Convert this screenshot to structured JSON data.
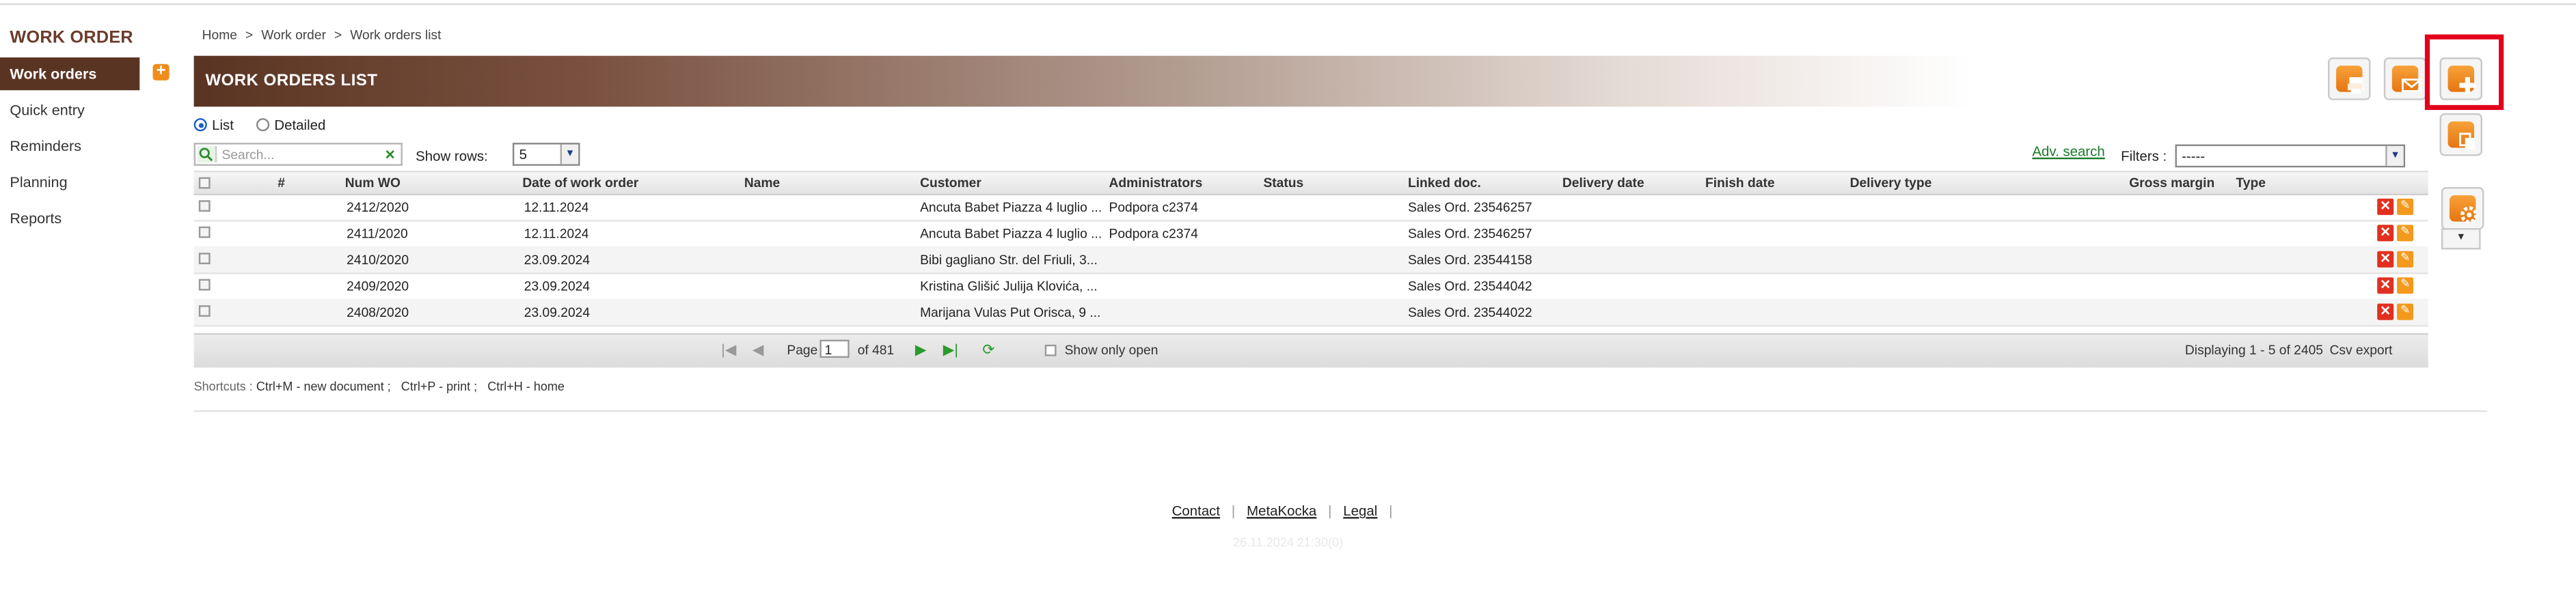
{
  "sidebar": {
    "title": "WORK ORDER",
    "items": [
      {
        "label": "Work orders"
      },
      {
        "label": "Quick entry"
      },
      {
        "label": "Reminders"
      },
      {
        "label": "Planning"
      },
      {
        "label": "Reports"
      }
    ],
    "add_glyph": "+"
  },
  "breadcrumb": [
    "Home",
    "Work order",
    "Work orders list"
  ],
  "breadcrumb_sep": ">",
  "header": {
    "title": "WORK ORDERS LIST"
  },
  "view": {
    "list_label": "List",
    "detailed_label": "Detailed",
    "selected": "List"
  },
  "search": {
    "placeholder": "Search...",
    "clear_glyph": "✕"
  },
  "rows": {
    "label": "Show rows:",
    "value": "5"
  },
  "adv_search": "Adv. search",
  "filters": {
    "label": "Filters :",
    "value": "-----"
  },
  "table": {
    "columns": [
      "#",
      "Num WO",
      "Date of work order",
      "Name",
      "Customer",
      "Administrators",
      "Status",
      "Linked doc.",
      "Delivery date",
      "Finish date",
      "Delivery type",
      "Gross margin",
      "Type"
    ],
    "rows": [
      {
        "num": "2412/2020",
        "date": "12.11.2024",
        "name": "",
        "customer": "Ancuta Babet Piazza 4 luglio ...",
        "admin": "Podpora c2374",
        "status": "",
        "linked": "Sales Ord. 23546257"
      },
      {
        "num": "2411/2020",
        "date": "12.11.2024",
        "name": "",
        "customer": "Ancuta Babet Piazza 4 luglio ...",
        "admin": "Podpora c2374",
        "status": "",
        "linked": "Sales Ord. 23546257"
      },
      {
        "num": "2410/2020",
        "date": "23.09.2024",
        "name": "",
        "customer": "Bibi gagliano Str. del Friuli, 3...",
        "admin": "",
        "status": "",
        "linked": "Sales Ord. 23544158"
      },
      {
        "num": "2409/2020",
        "date": "23.09.2024",
        "name": "",
        "customer": "Kristina Glišić Julija Klovića, ...",
        "admin": "",
        "status": "",
        "linked": "Sales Ord. 23544042"
      },
      {
        "num": "2408/2020",
        "date": "23.09.2024",
        "name": "",
        "customer": "Marijana Vulas Put Orisca, 9 ...",
        "admin": "",
        "status": "",
        "linked": "Sales Ord. 23544022"
      }
    ]
  },
  "pager": {
    "page_label": "Page",
    "page_value": "1",
    "of_label": "of 481",
    "show_open_label": "Show only open",
    "displaying": "Displaying 1 - 5 of 2405",
    "csv_export": "Csv export"
  },
  "shortcuts": {
    "label": "Shortcuts :",
    "items": [
      "Ctrl+M - new document ;",
      "Ctrl+P - print ;",
      "Ctrl+H - home"
    ]
  },
  "footer": {
    "links": [
      "Contact",
      "MetaKocka",
      "Legal"
    ],
    "sep": "|",
    "timestamp": "26.11.2024 21:30(0)"
  },
  "icons": {
    "print": "printer-icon",
    "email": "email-icon",
    "add": "plus-icon",
    "copy": "copy-icon",
    "settings": "gear-icon"
  },
  "colors": {
    "brand": "#5a3422",
    "accent": "#f08c1c",
    "highlight": "#e3001b"
  }
}
